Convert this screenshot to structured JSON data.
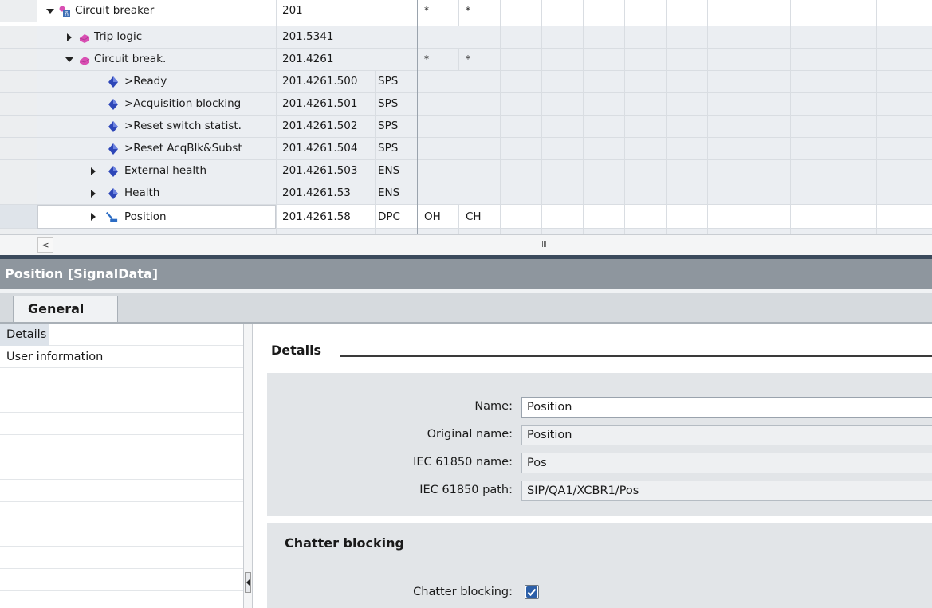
{
  "tree": {
    "rows": [
      {
        "name": "Circuit breaker",
        "address": "201",
        "type": "",
        "col1": "*",
        "col2": "*"
      },
      {
        "name": "Trip logic",
        "address": "201.5341",
        "type": "",
        "col1": "",
        "col2": ""
      },
      {
        "name": "Circuit break.",
        "address": "201.4261",
        "type": "",
        "col1": "*",
        "col2": "*"
      },
      {
        "name": ">Ready",
        "address": "201.4261.500",
        "type": "SPS",
        "col1": "",
        "col2": ""
      },
      {
        "name": ">Acquisition blocking",
        "address": "201.4261.501",
        "type": "SPS",
        "col1": "",
        "col2": ""
      },
      {
        "name": ">Reset switch statist.",
        "address": "201.4261.502",
        "type": "SPS",
        "col1": "",
        "col2": ""
      },
      {
        "name": ">Reset AcqBlk&Subst",
        "address": "201.4261.504",
        "type": "SPS",
        "col1": "",
        "col2": ""
      },
      {
        "name": "External health",
        "address": "201.4261.503",
        "type": "ENS",
        "col1": "",
        "col2": ""
      },
      {
        "name": "Health",
        "address": "201.4261.53",
        "type": "ENS",
        "col1": "",
        "col2": ""
      },
      {
        "name": "Position",
        "address": "201.4261.58",
        "type": "DPC",
        "col1": "OH",
        "col2": "CH"
      }
    ]
  },
  "scrollbar": {
    "left_arrow": "<",
    "grip": "III"
  },
  "inspector": {
    "title": "Position [SignalData]",
    "tabs": [
      {
        "label": "General"
      }
    ],
    "nav": [
      {
        "label": "Details"
      },
      {
        "label": "User information"
      }
    ],
    "section_title": "Details",
    "fields": {
      "name_label": "Name:",
      "name_value": "Position",
      "original_label": "Original name:",
      "original_value": "Position",
      "iec_name_label": "IEC 61850 name:",
      "iec_name_value": "Pos",
      "iec_path_label": "IEC 61850 path:",
      "iec_path_value": "SIP/QA1/XCBR1/Pos"
    },
    "chatter": {
      "title": "Chatter blocking",
      "label": "Chatter blocking:",
      "checked": true
    }
  },
  "colors": {
    "accent": "#2c5fa8",
    "title_bar": "#8e969e",
    "panel": "#e2e5e8"
  }
}
